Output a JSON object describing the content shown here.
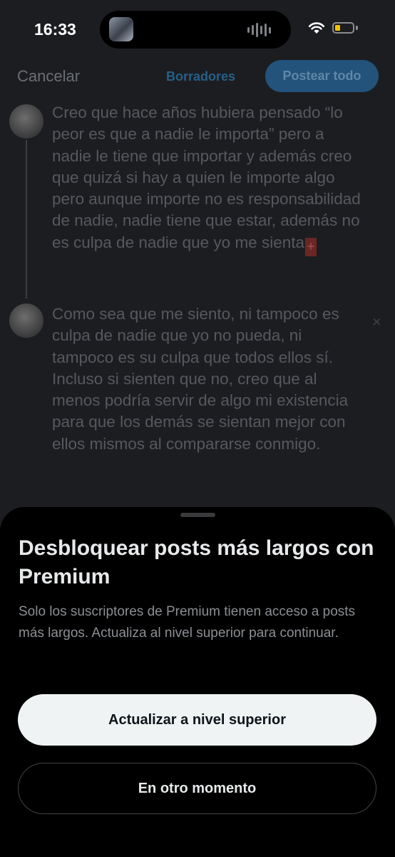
{
  "status_bar": {
    "time": "16:33",
    "icons": [
      "now-playing-thumbnail-icon",
      "audio-waveform-icon",
      "wifi-icon",
      "battery-icon"
    ]
  },
  "header": {
    "cancel_label": "Cancelar",
    "drafts_label": "Borradores",
    "post_all_label": "Postear todo"
  },
  "thread": {
    "posts": [
      {
        "text": "Creo que hace años hubiera pensado “lo peor es que a nadie le importa” pero a nadie le tiene que importar y además creo que quizá si hay a quien le importe algo pero aunque importe no es responsabilidad de nadie, nadie tiene que estar, además no es culpa de nadie que yo me sienta"
      },
      {
        "text": "Como sea que me siento, ni tampoco es culpa de nadie que yo no pueda, ni tampoco es su culpa que todos ellos sí. Incluso si sienten que no, creo que al menos podría servir de algo mi existencia para que los demás se sientan mejor con ellos mismos al compararse conmigo."
      }
    ],
    "overflow_marker": "+",
    "close_glyph": "×"
  },
  "sheet": {
    "title": "Desbloquear posts más largos con Premium",
    "description": "Solo los suscriptores de Premium tienen acceso a posts más largos. Actualiza al nivel superior para continuar.",
    "primary_button": "Actualizar a nivel superior",
    "secondary_button": "En otro momento"
  },
  "colors": {
    "accent": "#1d9bf0",
    "background": "#1c1d21",
    "sheet_background": "#000000",
    "primary_button_bg": "#eff3f4"
  }
}
